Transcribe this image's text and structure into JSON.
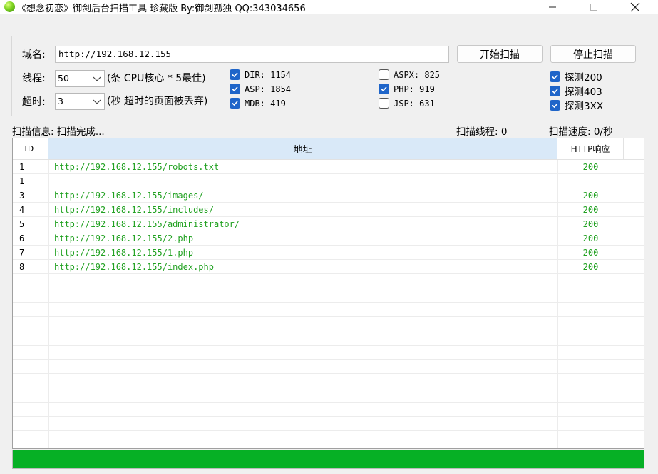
{
  "window": {
    "title": "《想念初恋》御剑后台扫描工具 珍藏版 By:御剑孤独 QQ:343034656"
  },
  "form": {
    "domain_label": "域名:",
    "domain_value": "http://192.168.12.155",
    "threads_label": "线程:",
    "threads_value": "50",
    "threads_hint": "(条 CPU核心 * 5最佳)",
    "timeout_label": "超时:",
    "timeout_value": "3",
    "timeout_hint": "(秒 超时的页面被丢弃)",
    "start_button": "开始扫描",
    "stop_button": "停止扫描"
  },
  "dictionaries": [
    {
      "label": "DIR: 1154",
      "checked": true
    },
    {
      "label": "ASP: 1854",
      "checked": true
    },
    {
      "label": "MDB: 419",
      "checked": true
    },
    {
      "label": "ASPX: 825",
      "checked": false
    },
    {
      "label": "PHP: 919",
      "checked": true
    },
    {
      "label": "JSP: 631",
      "checked": false
    }
  ],
  "probes": [
    {
      "label": "探测200",
      "checked": true
    },
    {
      "label": "探测403",
      "checked": true
    },
    {
      "label": "探测3XX",
      "checked": true
    }
  ],
  "status": {
    "info": "扫描信息: 扫描完成...",
    "threads": "扫描线程: 0",
    "speed": "扫描速度: 0/秒"
  },
  "table": {
    "headers": {
      "id": "ID",
      "address": "地址",
      "http": "HTTP响应"
    },
    "rows": [
      {
        "id": "1",
        "url": "http://192.168.12.155/robots.txt",
        "code": "200"
      },
      {
        "id": "1",
        "url": "",
        "code": ""
      },
      {
        "id": "3",
        "url": "http://192.168.12.155/images/",
        "code": "200"
      },
      {
        "id": "4",
        "url": "http://192.168.12.155/includes/",
        "code": "200"
      },
      {
        "id": "5",
        "url": "http://192.168.12.155/administrator/",
        "code": "200"
      },
      {
        "id": "6",
        "url": "http://192.168.12.155/2.php",
        "code": "200"
      },
      {
        "id": "7",
        "url": "http://192.168.12.155/1.php",
        "code": "200"
      },
      {
        "id": "8",
        "url": "http://192.168.12.155/index.php",
        "code": "200"
      }
    ]
  },
  "progress": {
    "fraction": 1.0
  },
  "colors": {
    "result_text": "#21a121",
    "checkbox_checked": "#1f65c9",
    "progress_fill": "#06b025",
    "header_highlight": "#d9e9f8"
  }
}
